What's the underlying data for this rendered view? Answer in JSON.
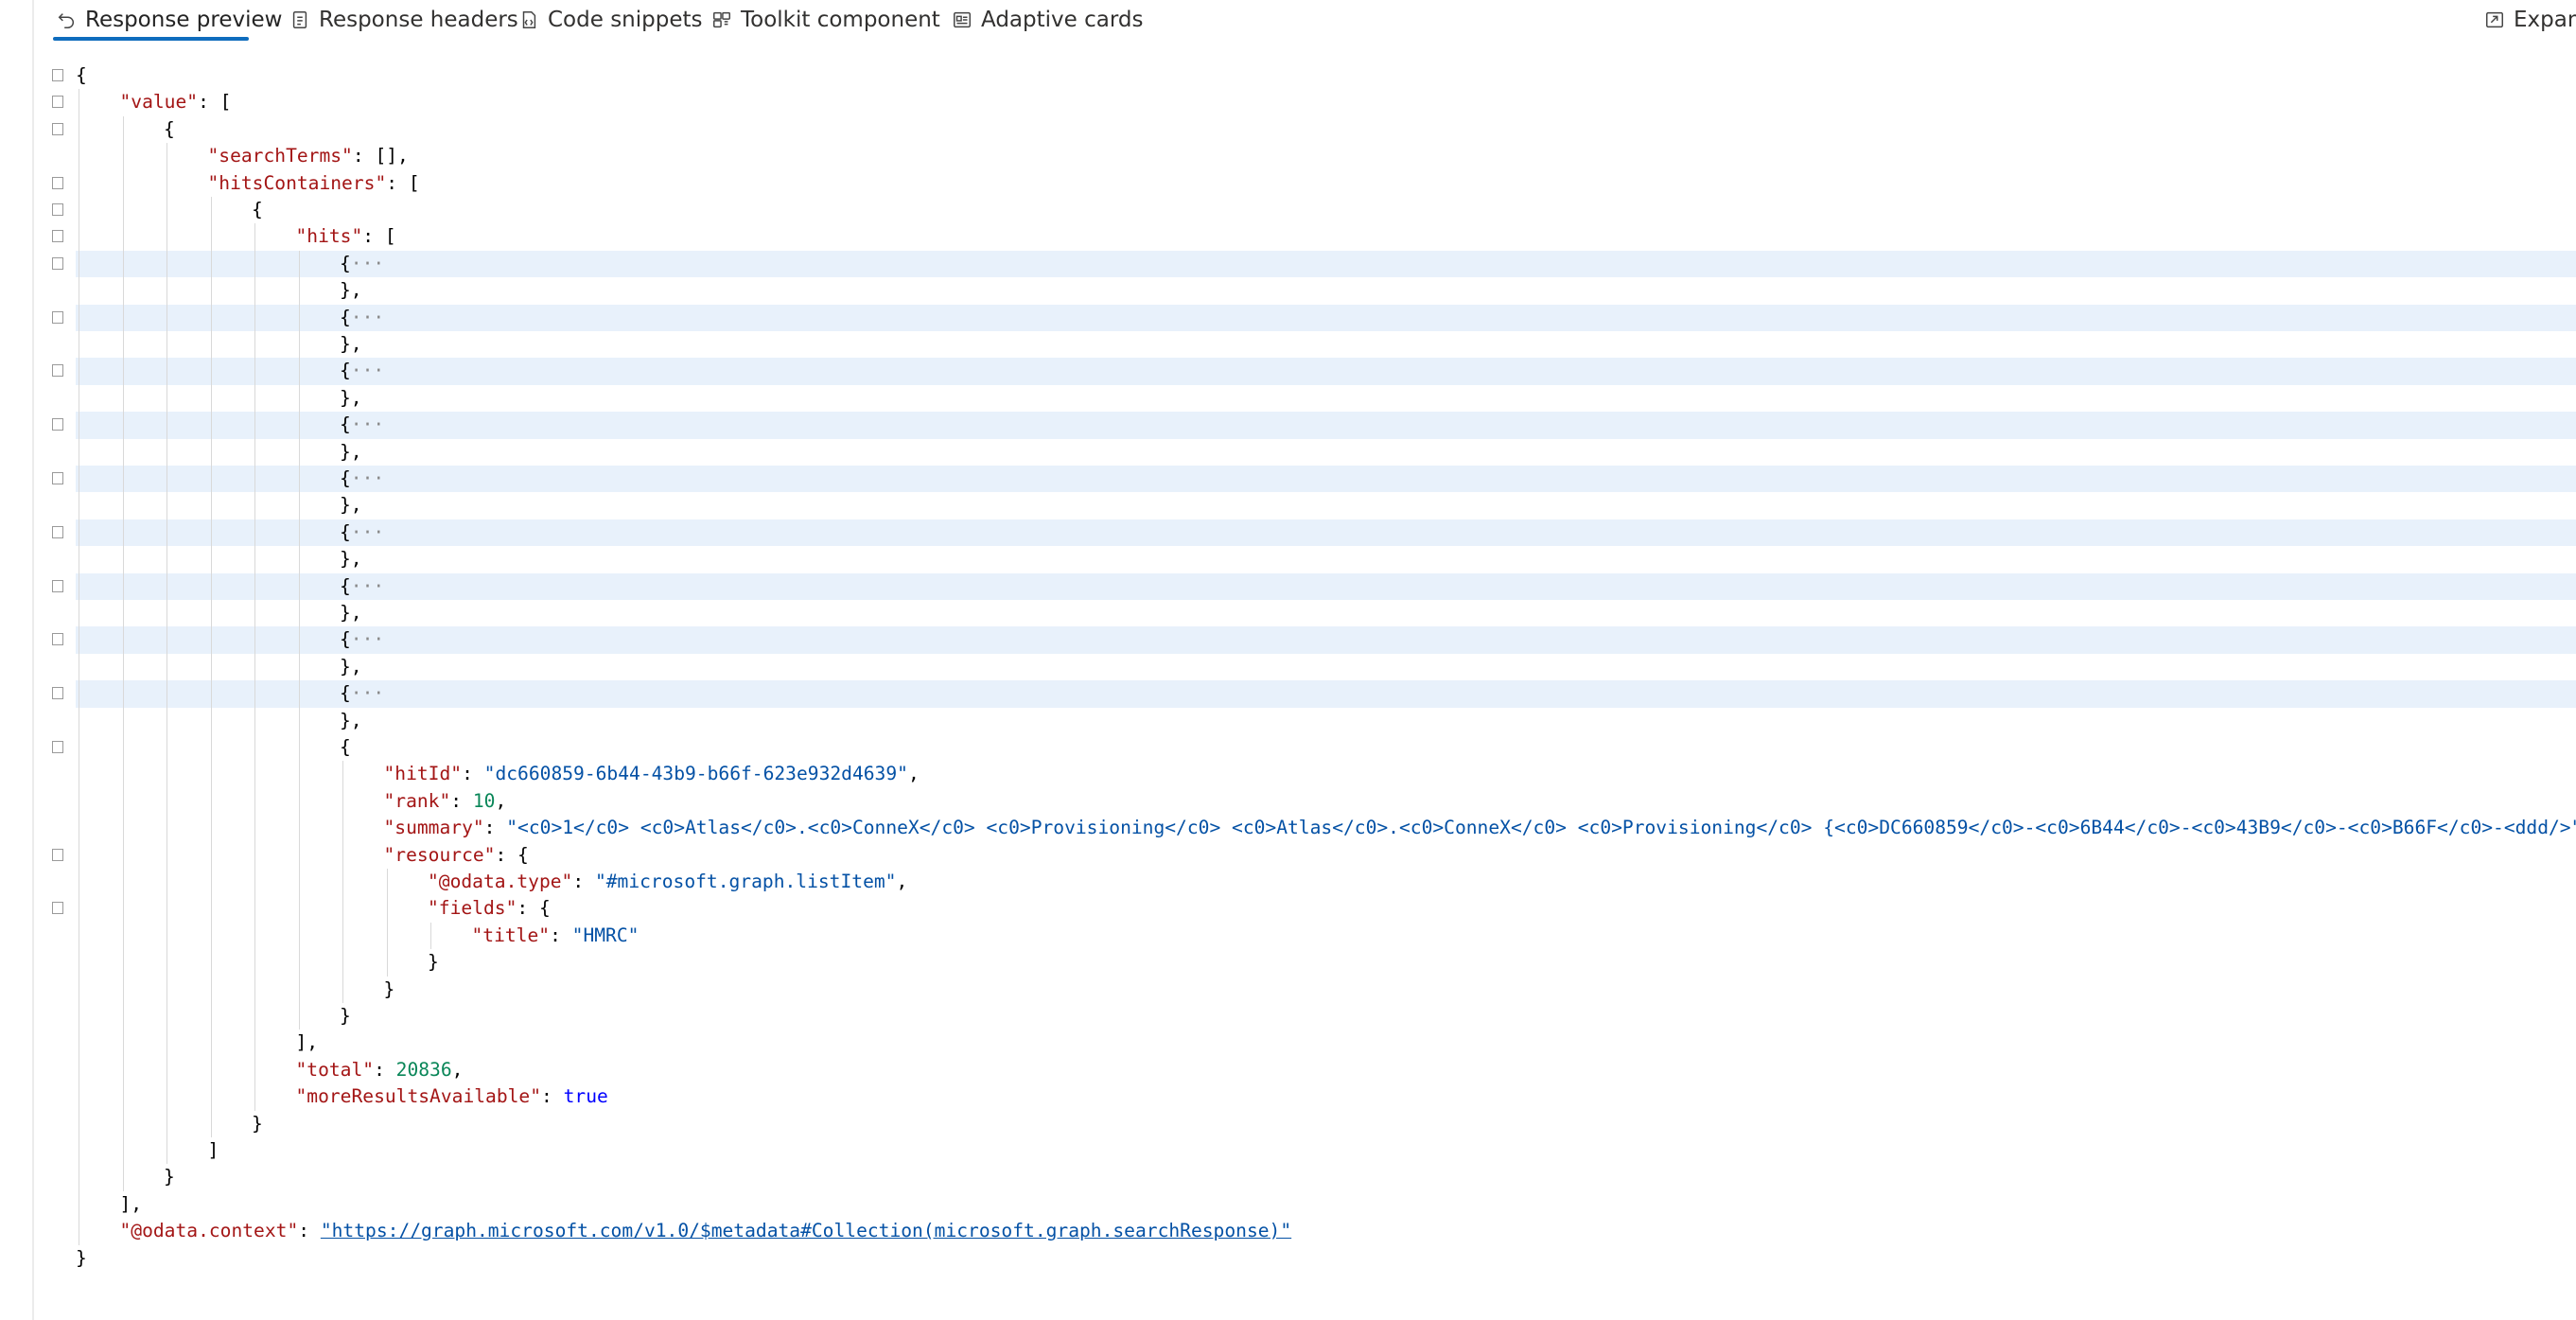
{
  "tabs": [
    {
      "label": "Response preview",
      "icon": "undo-arrow-icon",
      "active": true
    },
    {
      "label": "Response headers",
      "icon": "document-icon",
      "active": false
    },
    {
      "label": "Code snippets",
      "icon": "code-document-icon",
      "active": false
    },
    {
      "label": "Toolkit component",
      "icon": "toolkit-icon",
      "active": false
    },
    {
      "label": "Adaptive cards",
      "icon": "card-icon",
      "active": false
    }
  ],
  "expand": {
    "label": "Expand",
    "icon": "expand-icon"
  },
  "json": {
    "value_key": "\"value\"",
    "searchTerms_key": "\"searchTerms\"",
    "hitsContainers_key": "\"hitsContainers\"",
    "hits_key": "\"hits\"",
    "collapsed_hit_count": 9,
    "ellipsis": "···",
    "hitId_key": "\"hitId\"",
    "hitId_value": "\"dc660859-6b44-43b9-b66f-623e932d4639\"",
    "rank_key": "\"rank\"",
    "rank_value": "10",
    "summary_key": "\"summary\"",
    "summary_value": "\"<c0>1</c0> <c0>Atlas</c0>.<c0>ConneX</c0> <c0>Provisioning</c0> <c0>Atlas</c0>.<c0>ConneX</c0> <c0>Provisioning</c0> {<c0>DC660859</c0>-<c0>6B44</c0>-<c0>43B9</c0>-<c0>B66F</c0>-<ddd/>\"",
    "resource_key": "\"resource\"",
    "odata_type_key": "\"@odata.type\"",
    "odata_type_value": "\"#microsoft.graph.listItem\"",
    "fields_key": "\"fields\"",
    "title_key": "\"title\"",
    "title_value": "\"HMRC\"",
    "total_key": "\"total\"",
    "total_value": "20836",
    "moreResults_key": "\"moreResultsAvailable\"",
    "moreResults_value": "true",
    "context_key": "\"@odata.context\"",
    "context_value": "\"https://graph.microsoft.com/v1.0/$metadata#Collection(microsoft.graph.searchResponse)\""
  }
}
